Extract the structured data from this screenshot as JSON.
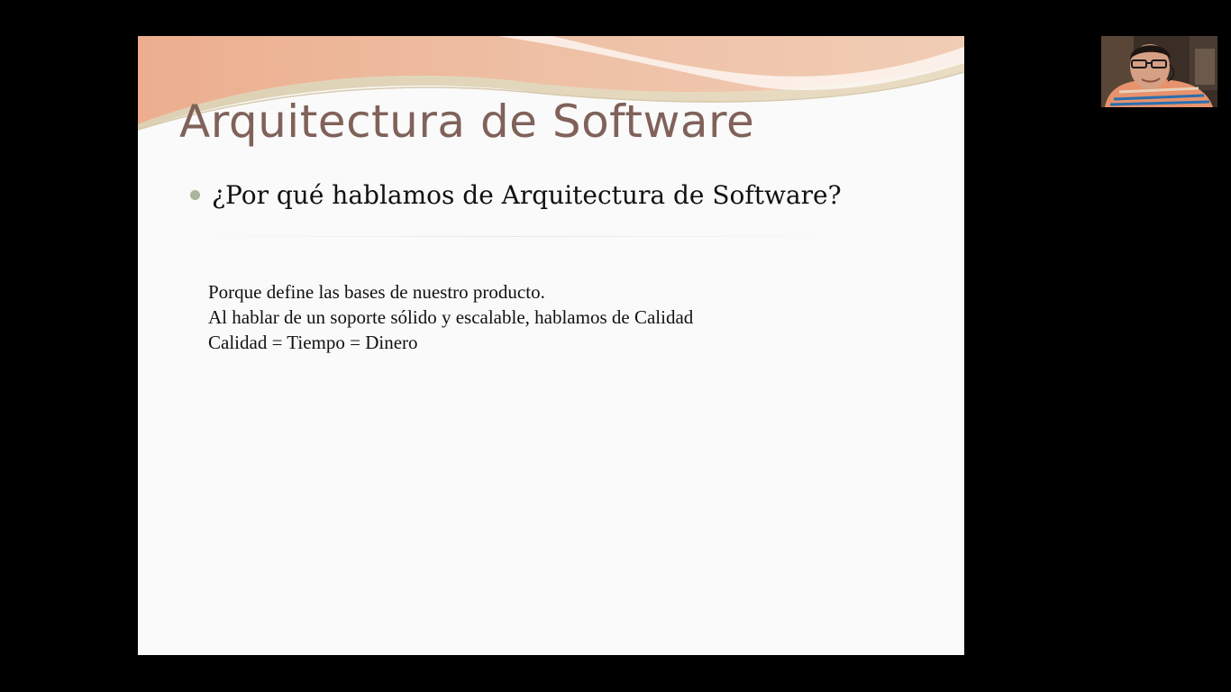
{
  "slide": {
    "title": "Arquitectura de Software",
    "bullet": "¿Por qué hablamos de Arquitectura de Software?",
    "lines": [
      "Porque define las bases de nuestro producto.",
      "Al hablar de un soporte sólido y escalable, hablamos de Calidad",
      "Calidad = Tiempo = Dinero"
    ],
    "colors": {
      "title": "#80625a",
      "bullet_dot": "#a9b59a",
      "header_peach": "#e8b696",
      "background": "#fafafa"
    }
  },
  "webcam": {
    "icon": "presenter-webcam-feed"
  }
}
